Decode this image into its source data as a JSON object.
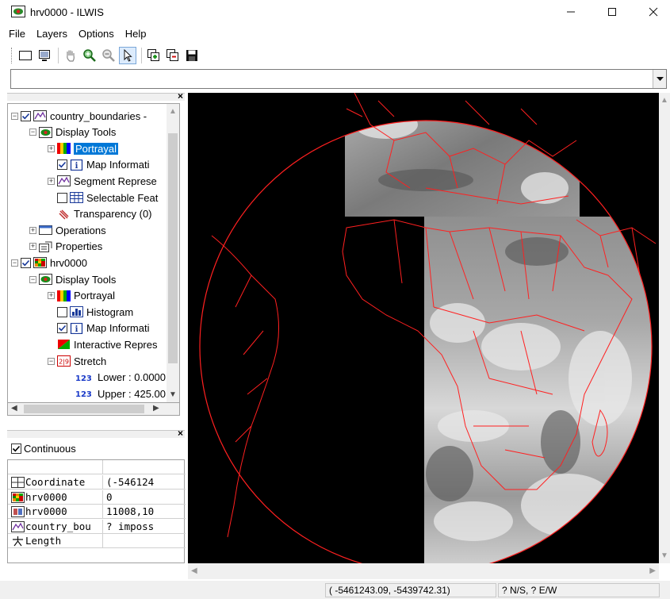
{
  "window": {
    "title": "hrv0000 - ILWIS"
  },
  "menu": [
    "File",
    "Layers",
    "Options",
    "Help"
  ],
  "toolbar": [
    "new-map-icon",
    "display-icon",
    "pan-icon",
    "zoom-in-icon",
    "zoom-out-icon",
    "select-pointer-icon",
    "add-layer-icon",
    "remove-layer-icon",
    "save-icon"
  ],
  "combo": {
    "value": ""
  },
  "tree": {
    "items": [
      {
        "label": "country_boundaries - ",
        "indent": 0,
        "exp": "−",
        "checked": true,
        "icon": "segment-map-icon"
      },
      {
        "label": "Display Tools",
        "indent": 1,
        "exp": "−",
        "checked": null,
        "icon": "display-tools-icon"
      },
      {
        "label": "Portrayal",
        "indent": 2,
        "exp": "+",
        "checked": null,
        "icon": "portrayal-icon",
        "selected": true
      },
      {
        "label": "Map Informati",
        "indent": 2,
        "exp": "",
        "checked": true,
        "icon": "info-icon"
      },
      {
        "label": "Segment Represe",
        "indent": 2,
        "exp": "+",
        "checked": null,
        "icon": "segment-map-icon"
      },
      {
        "label": "Selectable Feat",
        "indent": 2,
        "exp": "",
        "checked": false,
        "icon": "table-icon"
      },
      {
        "label": "Transparency (0)",
        "indent": 2,
        "exp": "",
        "checked": null,
        "icon": "transparency-icon"
      },
      {
        "label": "Operations",
        "indent": 1,
        "exp": "+",
        "checked": null,
        "icon": "operations-icon"
      },
      {
        "label": "Properties",
        "indent": 1,
        "exp": "+",
        "checked": null,
        "icon": "properties-icon"
      },
      {
        "label": "hrv0000",
        "indent": 0,
        "exp": "−",
        "checked": true,
        "icon": "raster-map-icon"
      },
      {
        "label": "Display Tools",
        "indent": 1,
        "exp": "−",
        "checked": null,
        "icon": "display-tools-icon"
      },
      {
        "label": "Portrayal",
        "indent": 2,
        "exp": "+",
        "checked": null,
        "icon": "portrayal-icon"
      },
      {
        "label": "Histogram",
        "indent": 2,
        "exp": "",
        "checked": false,
        "icon": "histogram-icon"
      },
      {
        "label": "Map Informati",
        "indent": 2,
        "exp": "",
        "checked": true,
        "icon": "info-icon"
      },
      {
        "label": "Interactive Repres",
        "indent": 2,
        "exp": "",
        "checked": null,
        "icon": "interactive-icon"
      },
      {
        "label": "Stretch",
        "indent": 2,
        "exp": "−",
        "checked": null,
        "icon": "stretch-icon"
      },
      {
        "label": "Lower : 0.0000",
        "indent": 3,
        "exp": "",
        "checked": null,
        "icon": "numeric-icon"
      },
      {
        "label": "Upper : 425.00",
        "indent": 3,
        "exp": "",
        "checked": null,
        "icon": "numeric-icon"
      }
    ]
  },
  "pixel_info": {
    "continuous_label": "Continuous",
    "continuous_checked": true,
    "rows": [
      {
        "name": "Coordinate",
        "value": "(-546124",
        "icon": "coordinate-icon"
      },
      {
        "name": "hrv0000",
        "value": "0",
        "icon": "raster-map-icon"
      },
      {
        "name": "hrv0000",
        "value": "11008,10",
        "icon": "georef-icon"
      },
      {
        "name": "country_bou",
        "value": "? imposs",
        "icon": "segment-map-icon"
      },
      {
        "name": "Length",
        "value": "",
        "icon": "length-icon"
      }
    ]
  },
  "status": {
    "coordinates": "( -5461243.09, -5439742.31)",
    "latlon": "? N/S, ? E/W"
  },
  "colors": {
    "selection": "#0078d7",
    "boundaries": "#ff2020",
    "map_bg": "#000000"
  }
}
